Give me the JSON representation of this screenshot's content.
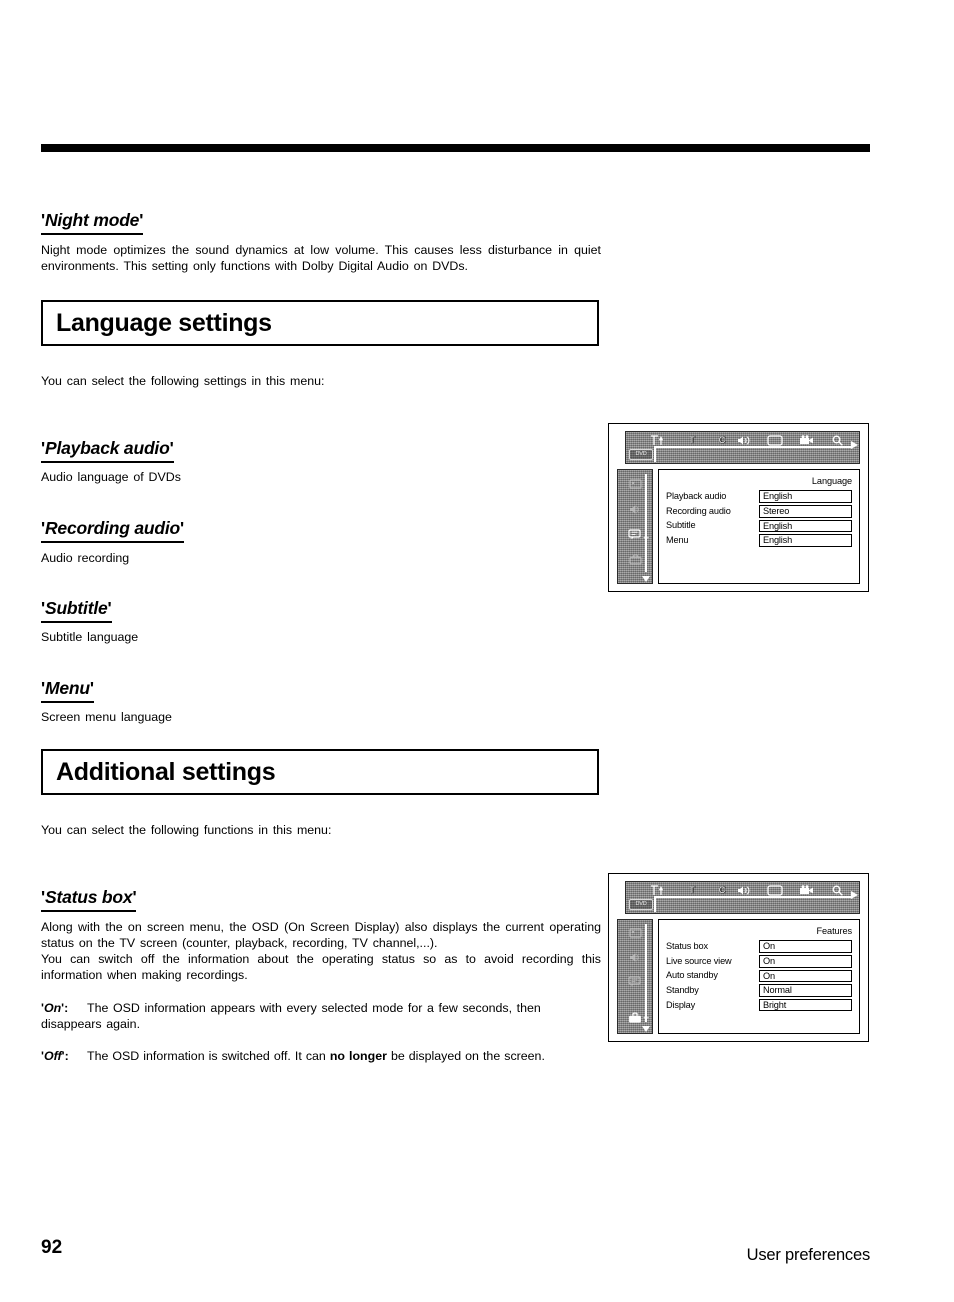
{
  "page": {
    "number": "92",
    "footer_title": "User preferences"
  },
  "night_mode": {
    "heading_open_quote": "'",
    "heading": "Night mode",
    "heading_close_quote": "'",
    "paragraph": "Night mode optimizes the sound dynamics at low volume. This causes less disturbance in quiet environments. This setting only functions with Dolby Digital Audio on DVDs."
  },
  "language_settings": {
    "title": "Language settings",
    "intro": "You can select the following settings in this menu:",
    "items": [
      {
        "heading": "Playback audio",
        "description": "Audio language of DVDs"
      },
      {
        "heading": "Recording audio",
        "description": "Audio recording"
      },
      {
        "heading": "Subtitle",
        "description": "Subtitle language"
      },
      {
        "heading": "Menu",
        "description": "Screen menu language"
      }
    ]
  },
  "additional_settings": {
    "title": "Additional settings",
    "intro": "You can select the following functions in this menu:",
    "status_box": {
      "heading": "Status box",
      "paragraph_1": "Along with the on screen menu, the OSD (On Screen Display) also displays the current operating status on the TV screen (counter, playback, recording, TV channel,...).",
      "paragraph_2": "You can switch off the information about the operating status so as to avoid recording this information when making recordings.",
      "options": [
        {
          "term": "On",
          "quote_open": "'",
          "quote_close": "':",
          "description_pre": "The OSD information appears with every selected mode for a few seconds, then disappears again.",
          "description_bold": "",
          "description_post": ""
        },
        {
          "term": "Off",
          "quote_open": "'",
          "quote_close": "':",
          "description_pre": "The OSD information is switched off. It can ",
          "description_bold": "no longer",
          "description_post": " be displayed on the screen."
        }
      ]
    }
  },
  "osd_language": {
    "dvd_badge": "DVD",
    "toolbar_icons": [
      "tools-icon",
      "timer-t-icon",
      "clock-c-icon",
      "speaker-icon",
      "tv-screen-icon",
      "camcorder-icon",
      "magnifier-icon"
    ],
    "sidebar_icons": [
      "picture-icon",
      "sound-speaker-icon",
      "language-bubble-icon",
      "features-toolbox-icon"
    ],
    "selected_sidebar_icon": "language-bubble-icon",
    "panel_title": "Language",
    "rows": [
      {
        "label": "Playback audio",
        "value": "English"
      },
      {
        "label": "Recording audio",
        "value": "Stereo"
      },
      {
        "label": "Subtitle",
        "value": "English"
      },
      {
        "label": "Menu",
        "value": "English"
      }
    ]
  },
  "osd_features": {
    "dvd_badge": "DVD",
    "toolbar_icons": [
      "tools-icon",
      "timer-t-icon",
      "clock-c-icon",
      "speaker-icon",
      "tv-screen-icon",
      "camcorder-icon",
      "magnifier-icon"
    ],
    "sidebar_icons": [
      "picture-icon",
      "sound-speaker-icon",
      "language-bubble-icon",
      "features-toolbox-icon"
    ],
    "selected_sidebar_icon": "features-toolbox-icon",
    "panel_title": "Features",
    "rows": [
      {
        "label": "Status box",
        "value": "On"
      },
      {
        "label": "Live source view",
        "value": "On"
      },
      {
        "label": "Auto standby",
        "value": "On"
      },
      {
        "label": "Standby",
        "value": "Normal"
      },
      {
        "label": "Display",
        "value": "Bright"
      }
    ]
  },
  "colors": {
    "ink": "#000000",
    "paper": "#ffffff",
    "osd_chrome": "#8d8d8d"
  }
}
